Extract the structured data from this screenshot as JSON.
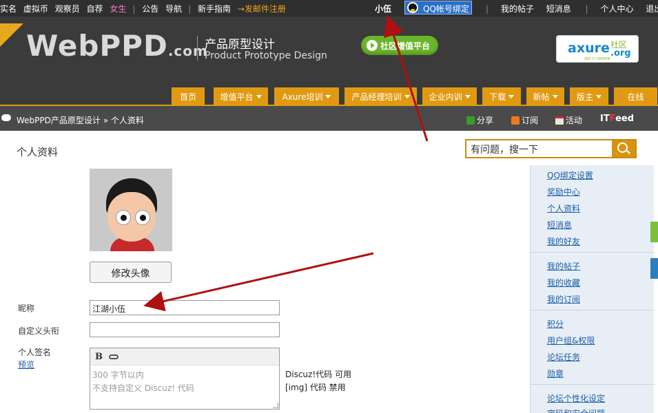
{
  "topbar": {
    "left_links": [
      "实名",
      "虚拟币",
      "观察员",
      "自荐",
      "女生",
      "公告",
      "导航",
      "新手指南",
      "→发邮件注册"
    ],
    "username": "小伍",
    "qq_bind": "QQ帐号绑定",
    "right_links": [
      "我的帖子",
      "短消息",
      "个人中心",
      "退出"
    ]
  },
  "header": {
    "logo_main": "WebPPD",
    "logo_suffix": ".com",
    "tagline_cn": "产品原型设计",
    "tagline_en": "Product Prototype Design",
    "social_button": "社区增值平台",
    "axure": {
      "word": "axure",
      "community": "社区",
      "org": ".org",
      "slogan": "SEE IT HAPPEN"
    },
    "nav": [
      {
        "label": "首页",
        "caret": false
      },
      {
        "label": "增值平台",
        "caret": true
      },
      {
        "label": "Axure培训",
        "caret": true
      },
      {
        "label": "产品经理培训",
        "caret": true
      },
      {
        "label": "企业内训",
        "caret": true
      },
      {
        "label": "下载",
        "caret": true
      },
      {
        "label": "新帖",
        "caret": true
      },
      {
        "label": "版主",
        "caret": true
      },
      {
        "label": "在线",
        "caret": false
      }
    ]
  },
  "breadcrumb": {
    "text": "WebPPD产品原型设计 » 个人资料"
  },
  "tools": {
    "share": "分享",
    "subscribe": "订阅",
    "activity": "活动",
    "itfeed_it": "IT",
    "itfeed_f": "F",
    "itfeed_rest": "eed"
  },
  "main": {
    "title": "个人资料",
    "search_placeholder": "有问题，搜一下",
    "change_avatar": "修改头像",
    "nickname_label": "昵称",
    "nickname_value": "江湖小伍",
    "custom_title_label": "自定义头衔",
    "custom_title_value": "",
    "signature_label": "个人签名",
    "preview_link": "预览",
    "editor_bold": "B",
    "signature_hint1": "300 字节以内",
    "signature_hint2": "不支持自定义 Discuz! 代码",
    "discuz_code": "Discuz!代码 可用",
    "img_code": "[img] 代码 禁用"
  },
  "sidebar": {
    "group1": [
      "QQ绑定设置",
      "奖励中心",
      "个人资料",
      "短消息",
      "我的好友"
    ],
    "group2": [
      "我的帖子",
      "我的收藏",
      "我的订阅"
    ],
    "group3": [
      "积分",
      "用户组&权限",
      "论坛任务",
      "勋章"
    ],
    "group4": [
      "论坛个性化设定",
      "密码和安全问题"
    ]
  },
  "colors": {
    "accent": "#e09a12",
    "header_bg": "#3b3b3b",
    "link": "#1a5fa8",
    "arrow": "#b01010"
  }
}
